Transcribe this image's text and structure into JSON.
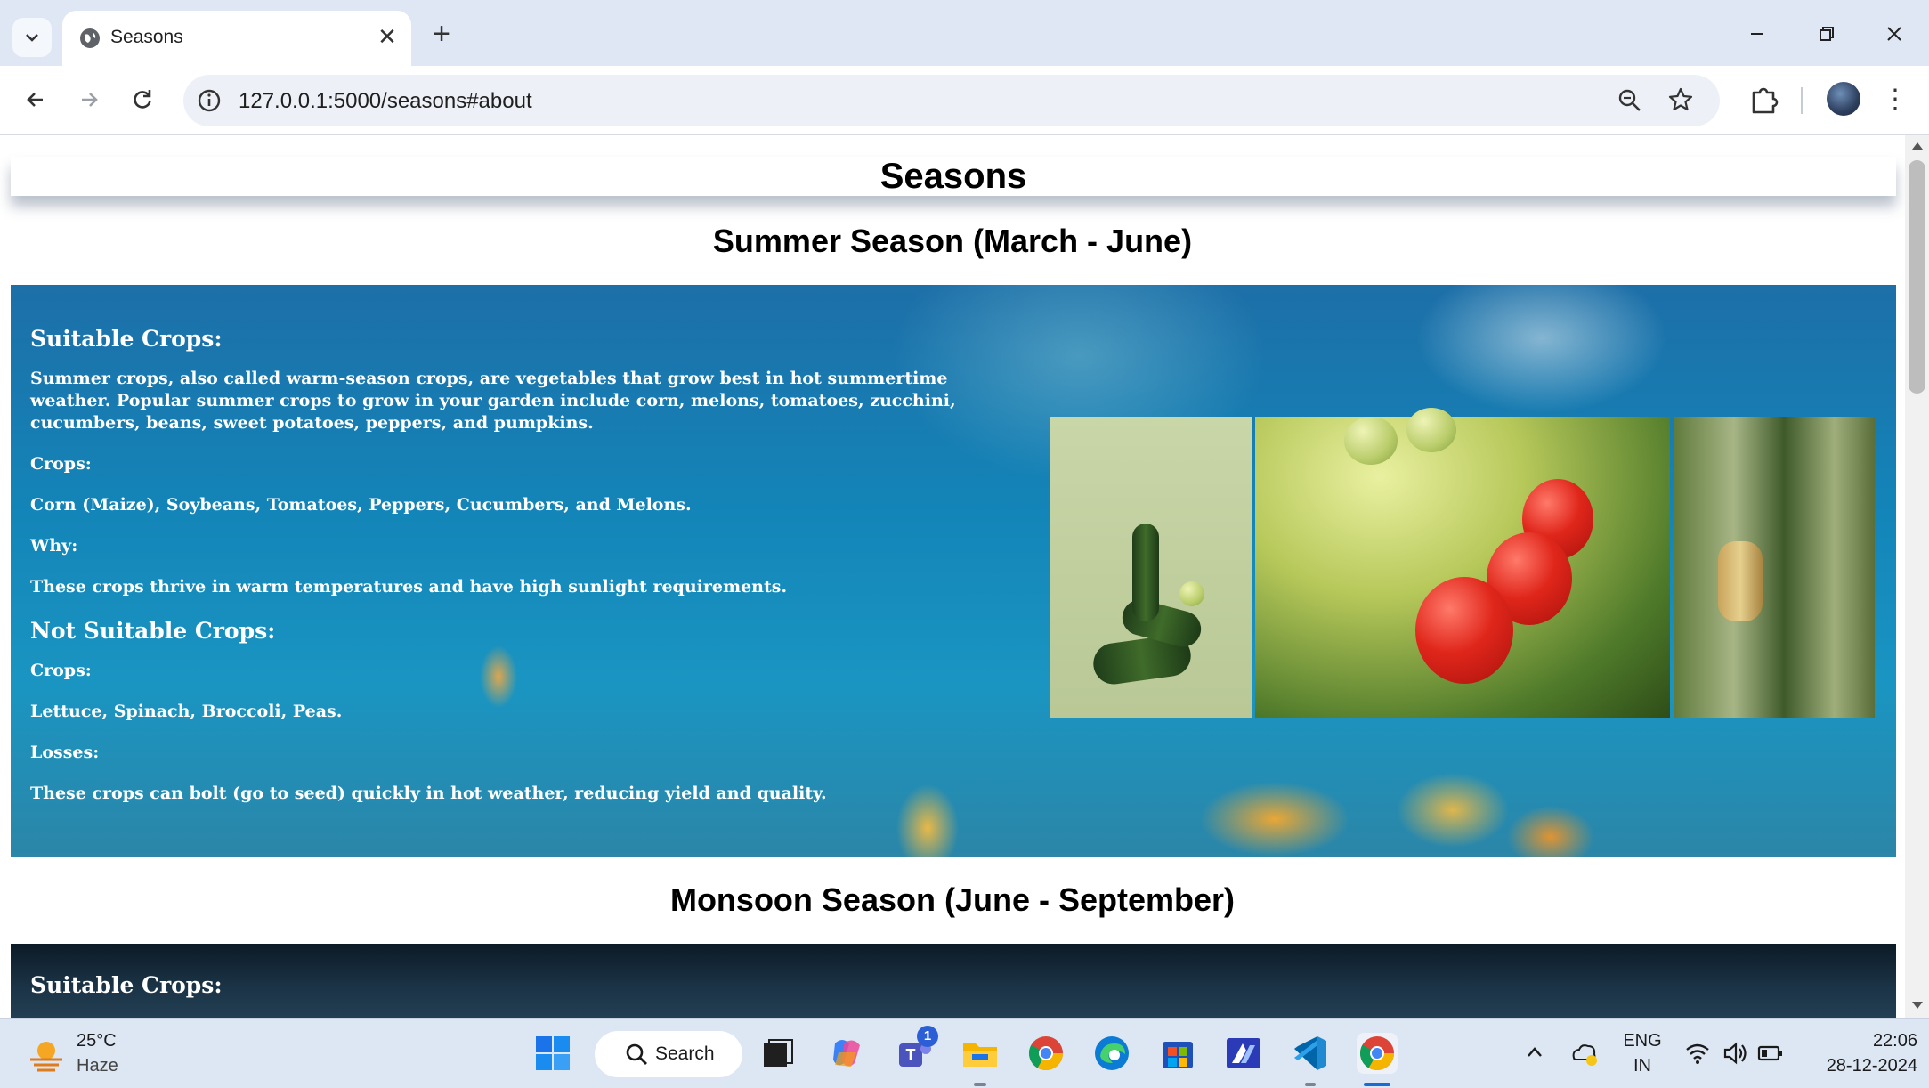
{
  "browser": {
    "tab_title": "Seasons",
    "new_tab_symbol": "+",
    "url": "127.0.0.1:5000/seasons#about",
    "window_controls": {
      "minimize": "—",
      "restore": "❐",
      "close": "✕"
    },
    "menu_symbol": "⋮"
  },
  "page": {
    "header_title": "Seasons",
    "seasons": [
      {
        "title": "Summer Season (March - June)",
        "suitable_heading": "Suitable Crops:",
        "intro": "Summer crops, also called warm-season crops, are vegetables that grow best in hot summertime weather. Popular summer crops to grow in your garden include corn, melons, tomatoes, zucchini, cucumbers, beans, sweet potatoes, peppers, and pumpkins.",
        "crops_label": "Crops:",
        "crops": "Corn (Maize), Soybeans, Tomatoes, Peppers, Cucumbers, and Melons.",
        "why_label": "Why:",
        "why": "These crops thrive in warm temperatures and have high sunlight requirements.",
        "not_suitable_heading": "Not Suitable Crops:",
        "not_crops_label": "Crops:",
        "not_crops": "Lettuce, Spinach, Broccoli, Peas.",
        "losses_label": "Losses:",
        "losses": "These crops can bolt (go to seed) quickly in hot weather, reducing yield and quality."
      },
      {
        "title": "Monsoon Season (June - September)",
        "suitable_heading": "Suitable Crops:"
      }
    ]
  },
  "taskbar": {
    "weather_temp": "25°C",
    "weather_desc": "Haze",
    "search_label": "Search",
    "teams_badge": "1",
    "language": "ENG",
    "region": "IN",
    "time": "22:06",
    "date": "28-12-2024"
  },
  "colors": {
    "chrome_frame": "#dfe7f5",
    "omnibox": "#edf1f7",
    "taskbar": "#dde6f3",
    "summer_panel": "#1385b8",
    "monsoon_panel": "#1b3346",
    "active_indicator": "#1a6bd6"
  }
}
